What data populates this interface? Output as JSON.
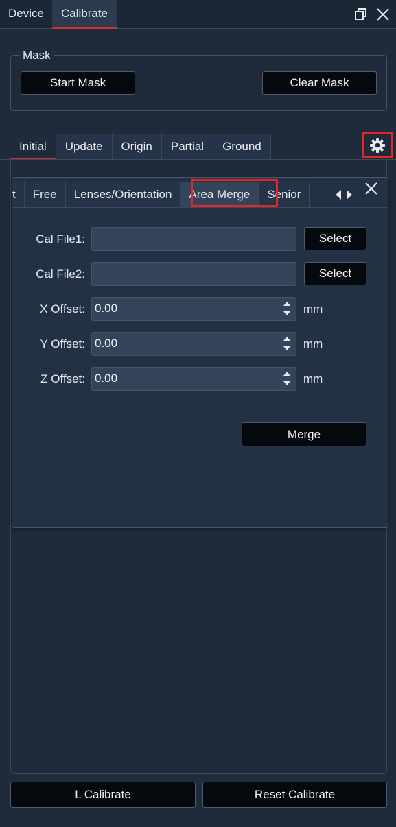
{
  "topbar": {
    "tabs": [
      {
        "label": "Device"
      },
      {
        "label": "Calibrate"
      }
    ]
  },
  "mask": {
    "title": "Mask",
    "start_label": "Start Mask",
    "clear_label": "Clear Mask"
  },
  "mode_tabs": [
    {
      "label": "Initial"
    },
    {
      "label": "Update"
    },
    {
      "label": "Origin"
    },
    {
      "label": "Partial"
    },
    {
      "label": "Ground"
    }
  ],
  "sub_tabs": [
    {
      "label": "t"
    },
    {
      "label": "Free"
    },
    {
      "label": "Lenses/Orientation"
    },
    {
      "label": "Area Merge"
    },
    {
      "label": "Senior"
    }
  ],
  "area_merge": {
    "cal_file1_label": "Cal File1:",
    "cal_file1_value": "",
    "cal_file2_label": "Cal File2:",
    "cal_file2_value": "",
    "select_label": "Select",
    "x_offset_label": "X Offset:",
    "x_offset_value": "0.00",
    "y_offset_label": "Y Offset:",
    "y_offset_value": "0.00",
    "z_offset_label": "Z Offset:",
    "z_offset_value": "0.00",
    "unit": "mm",
    "merge_label": "Merge"
  },
  "bottom": {
    "l_calibrate": "L Calibrate",
    "reset_calibrate": "Reset Calibrate"
  },
  "colors": {
    "background": "#1f2b3b",
    "highlight": "#e32626",
    "active_tab_underline": "#d32f2f",
    "button_bg": "#05080c",
    "field_bg": "#34445a"
  },
  "icons": [
    "restore-window-icon",
    "close-icon",
    "gear-icon",
    "chevron-left-icon",
    "chevron-right-icon",
    "spin-up-icon",
    "spin-down-icon"
  ]
}
